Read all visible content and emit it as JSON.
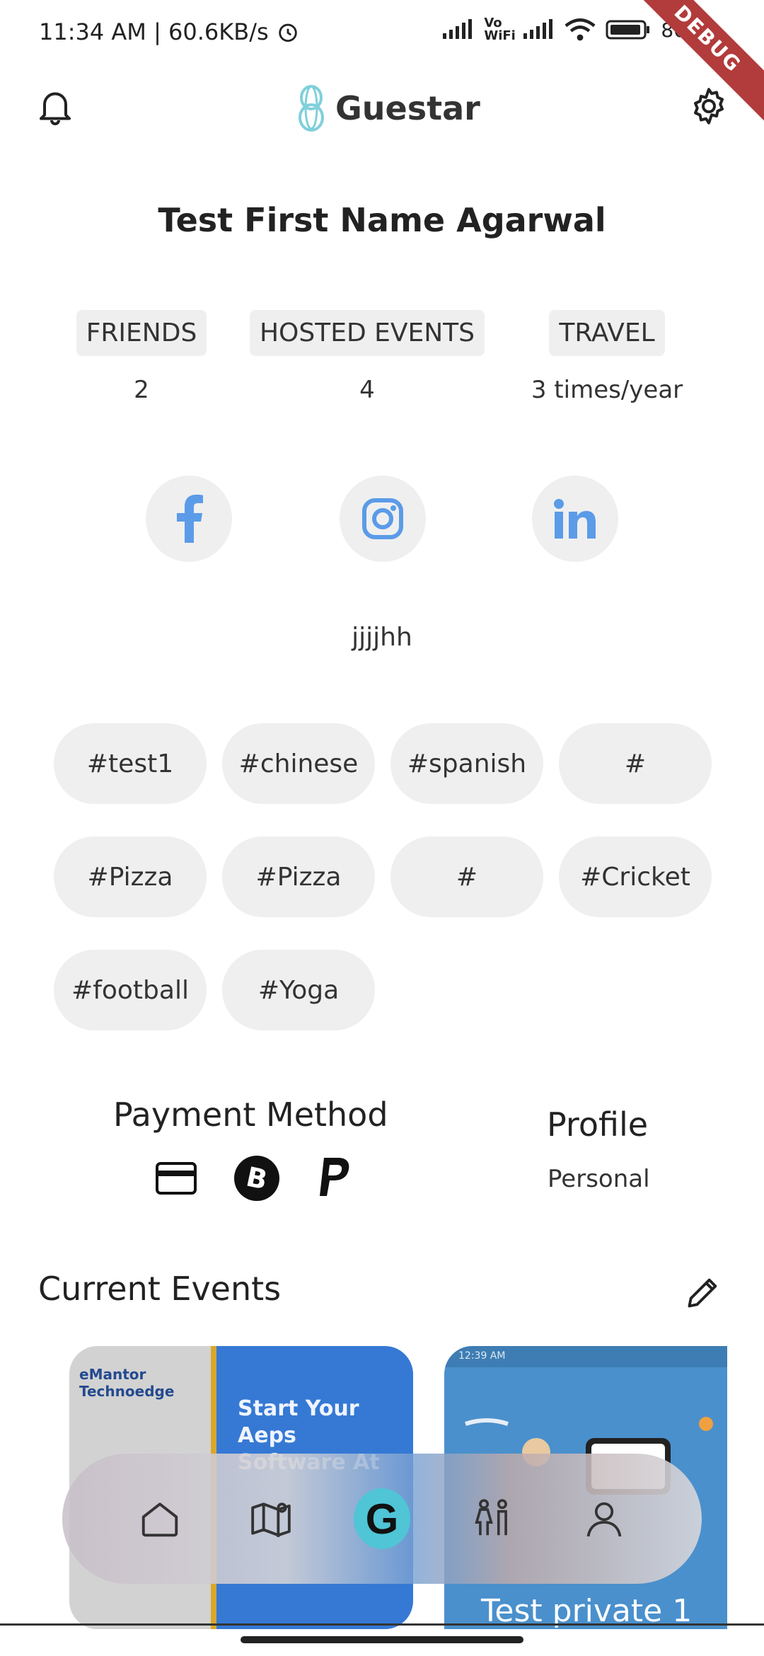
{
  "status_bar": {
    "time": "11:34 AM | 60.6KB/s",
    "network_label": "Vo WiFi",
    "battery": "86",
    "debug_label": "DEBUG"
  },
  "header": {
    "brand": "Guestar",
    "left_icon": "bell-icon",
    "right_icon": "gear-icon"
  },
  "profile": {
    "name": "Test First Name Agarwal",
    "bio": "jjjjhh"
  },
  "stats": [
    {
      "label": "FRIENDS",
      "value": "2"
    },
    {
      "label": "HOSTED EVENTS",
      "value": "4"
    },
    {
      "label": "TRAVEL",
      "value": "3 times/year"
    }
  ],
  "social_icons": [
    "facebook-icon",
    "instagram-icon",
    "linkedin-icon"
  ],
  "tags": [
    "#test1",
    "#chinese",
    "#spanish",
    "#",
    "#Pizza",
    "#Pizza",
    "#",
    "#Cricket",
    "#football",
    "#Yoga"
  ],
  "payment": {
    "title": "Payment Method",
    "icons": [
      "credit-card-icon",
      "bitcoin-icon",
      "paypal-icon"
    ]
  },
  "profile_type": {
    "title": "Profile",
    "value": "Personal"
  },
  "events": {
    "title": "Current Events",
    "cards": [
      {
        "logo": "eMantor Technoedge",
        "headline": "Start Your Aeps Software At"
      },
      {
        "status": "12:39 AM",
        "title": "Test private 1"
      }
    ]
  },
  "bottom_nav": [
    "home-icon",
    "map-icon",
    "guestar-g-icon",
    "people-icon",
    "profile-icon"
  ],
  "colors": {
    "accent": "#4fc5d6",
    "social_icon": "#5b9be8",
    "chip_bg": "#efefef"
  }
}
